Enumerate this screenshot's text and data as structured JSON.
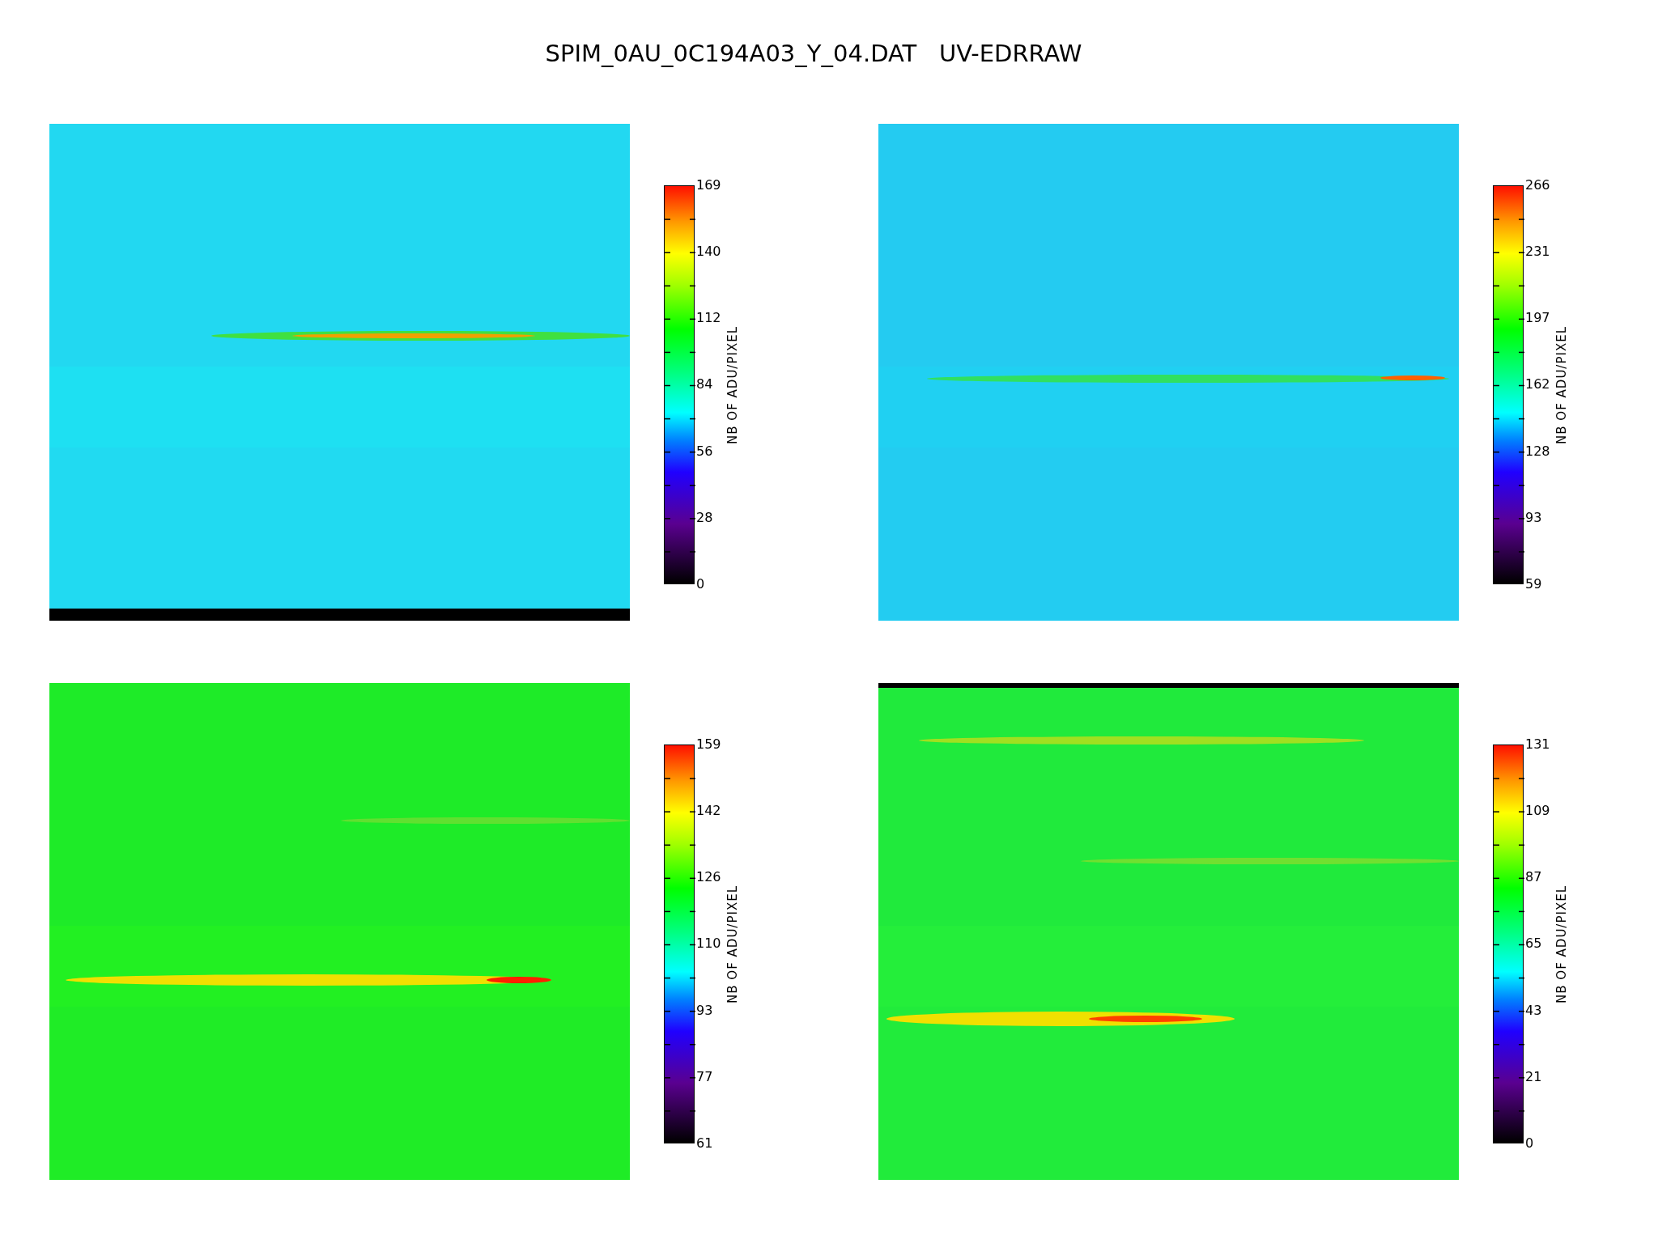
{
  "title": "SPIM_0AU_0C194A03_Y_04.DAT   UV-EDRRAW",
  "panels": [
    {
      "colorbar": {
        "label": "NB OF ADU/PIXEL",
        "ticks": [
          "169",
          "140",
          "112",
          "84",
          "56",
          "28",
          "0"
        ]
      }
    },
    {
      "colorbar": {
        "label": "NB OF ADU/PIXEL",
        "ticks": [
          "266",
          "231",
          "197",
          "162",
          "128",
          "93",
          "59"
        ]
      }
    },
    {
      "colorbar": {
        "label": "NB OF ADU/PIXEL",
        "ticks": [
          "159",
          "142",
          "126",
          "110",
          "93",
          "77",
          "61"
        ]
      }
    },
    {
      "colorbar": {
        "label": "NB OF ADU/PIXEL",
        "ticks": [
          "131",
          "109",
          "87",
          "65",
          "43",
          "21",
          "0"
        ]
      }
    }
  ]
}
